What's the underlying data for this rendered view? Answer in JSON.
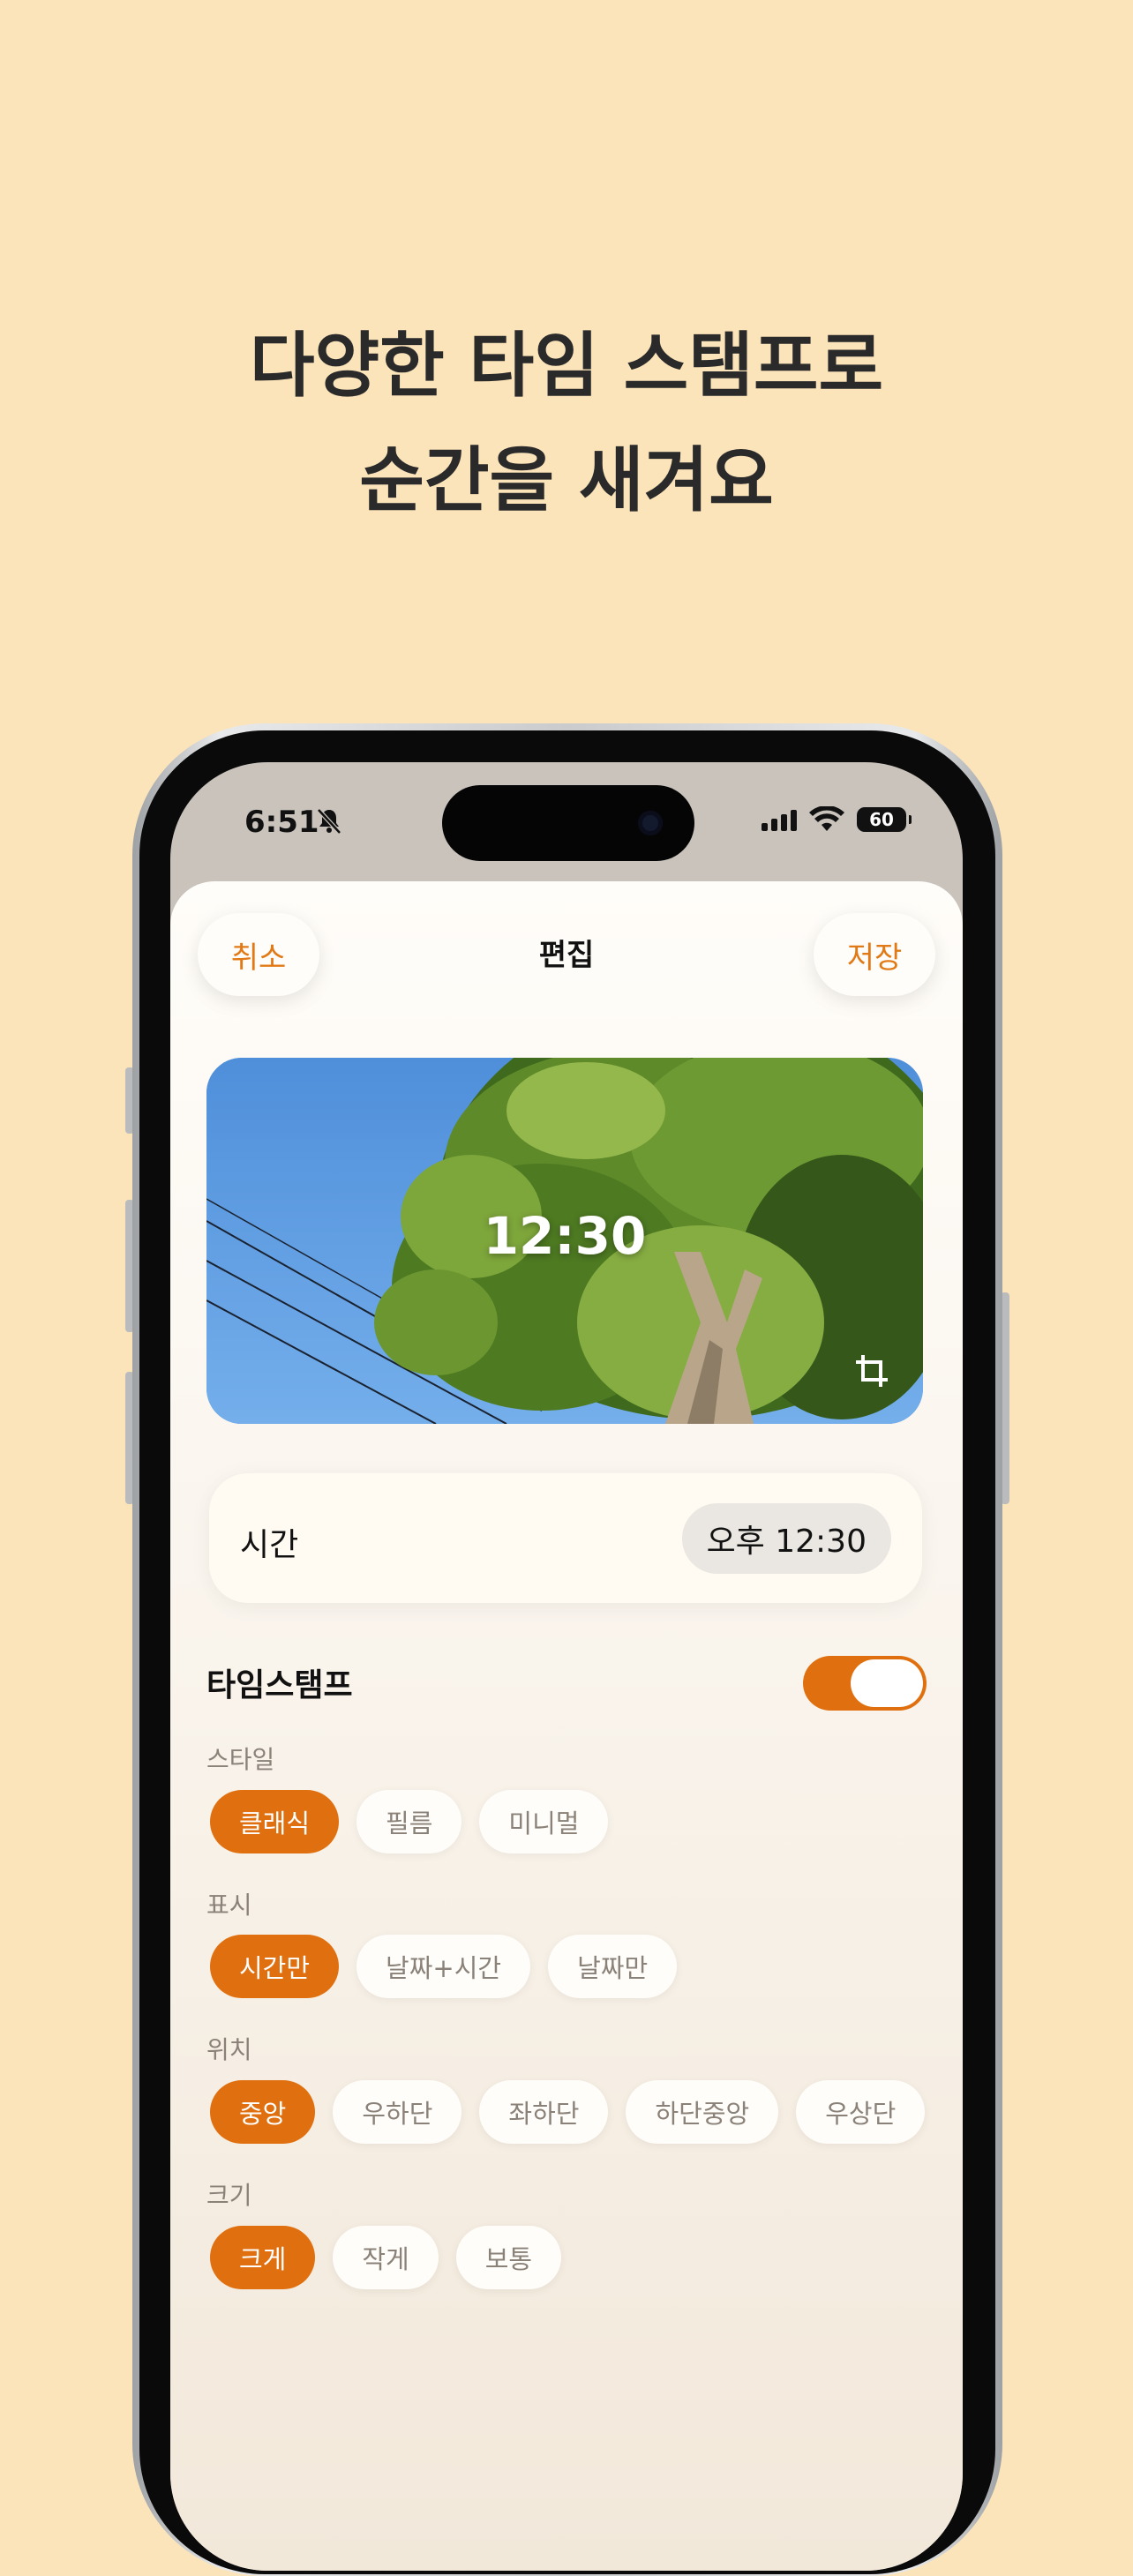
{
  "headline": {
    "line1": "다양한 타임 스탬프로",
    "line2": "순간을 새겨요"
  },
  "status_bar": {
    "time": "6:51",
    "battery": "60"
  },
  "nav": {
    "cancel": "취소",
    "title": "편집",
    "save": "저장"
  },
  "photo": {
    "overlay_time": "12:30"
  },
  "time_row": {
    "label": "시간",
    "value": "오후 12:30"
  },
  "timestamp": {
    "title": "타임스탬프",
    "enabled": true,
    "sections": {
      "style": {
        "label": "스타일",
        "options": [
          "클래식",
          "필름",
          "미니멀"
        ],
        "selected": "클래식"
      },
      "display": {
        "label": "표시",
        "options": [
          "시간만",
          "날짜+시간",
          "날짜만"
        ],
        "selected": "시간만"
      },
      "position": {
        "label": "위치",
        "options": [
          "중앙",
          "우하단",
          "좌하단",
          "하단중앙",
          "우상단"
        ],
        "selected": "중앙"
      },
      "size": {
        "label": "크기",
        "options": [
          "크게",
          "작게",
          "보통"
        ],
        "selected": "크게"
      }
    }
  },
  "colors": {
    "accent": "#E0700F",
    "background": "#FCE4BA"
  },
  "icons": [
    "bell-slash-icon",
    "signal-icon",
    "wifi-icon",
    "battery-icon",
    "crop-icon"
  ]
}
